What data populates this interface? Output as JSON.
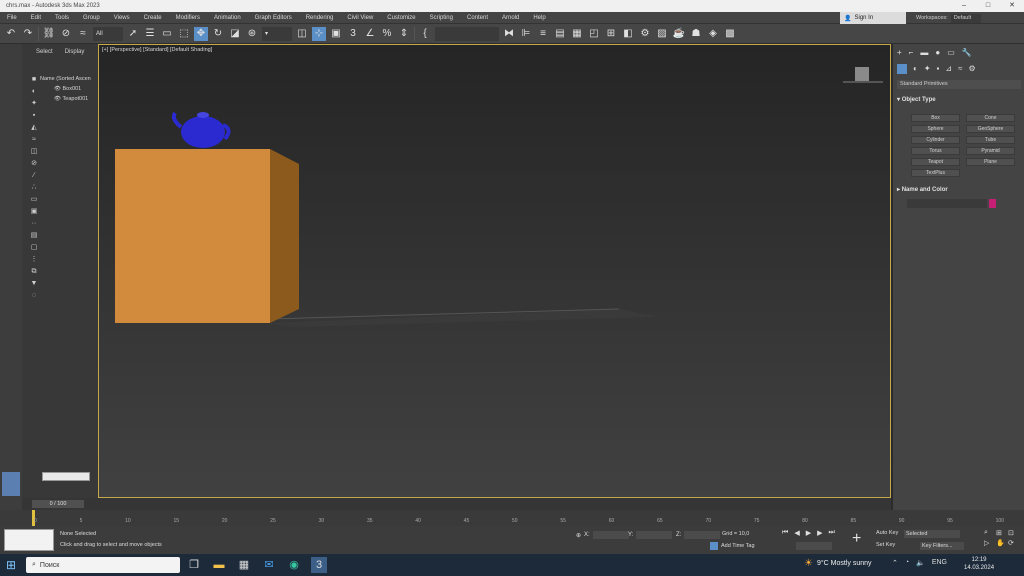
{
  "window": {
    "title": "chrs.max - Autodesk 3ds Max 2023",
    "controls": [
      "–",
      "□",
      "✕"
    ]
  },
  "menubar": {
    "items": [
      "File",
      "Edit",
      "Tools",
      "Group",
      "Views",
      "Create",
      "Modifiers",
      "Animation",
      "Graph Editors",
      "Rendering",
      "Civil View",
      "Customize",
      "Scripting",
      "Content",
      "Arnold",
      "Help"
    ],
    "sign_in": "Sign In",
    "workspaces_label": "Workspaces:",
    "workspace_value": "Default"
  },
  "toolbar": {
    "selection_filter": "All",
    "icons": [
      "undo-icon",
      "redo-icon",
      "link-icon",
      "unlink-icon",
      "bind-space-warp-icon",
      "select-icon",
      "select-by-name-icon",
      "rect-region-icon",
      "window-crossing-icon",
      "select-move-icon",
      "select-rotate-icon",
      "select-scale-icon",
      "placement-icon",
      "ref-coord-icon",
      "pivot-icon",
      "snap-icon",
      "angle-snap-icon",
      "percent-snap-icon",
      "spinner-snap-icon",
      "edit-named-sel-icon",
      "mirror-icon",
      "align-icon",
      "layer-icon",
      "toggle-ribbon-icon",
      "curve-editor-icon",
      "schematic-icon",
      "material-editor-icon",
      "render-setup-icon",
      "rendered-frame-icon",
      "render-icon"
    ],
    "accent": "#5b8fc7"
  },
  "scene_explorer": {
    "tabs": [
      "Select",
      "Display"
    ],
    "items": [
      {
        "label": "Name (Sorted Ascen"
      },
      {
        "label": "Box001"
      },
      {
        "label": "Teapot001"
      }
    ]
  },
  "viewport": {
    "label": "[+] [Perspective] [Standard] [Default Shading]",
    "border_color": "#c4a84a",
    "box_color": "#d28a3c",
    "teapot_color": "#2a2ad0"
  },
  "command_panel": {
    "dropdown": "Standard Primitives",
    "object_type_title": "Object Type",
    "object_types": [
      "Box",
      "Cone",
      "Sphere",
      "GeoSphere",
      "Cylinder",
      "Tube",
      "Torus",
      "Pyramid",
      "Teapot",
      "Plane",
      "TextPlus"
    ],
    "name_color_title": "Name and Color",
    "object_color": "#c41f74"
  },
  "timeline": {
    "frame_display": "0 / 100",
    "ticks": [
      "0",
      "5",
      "10",
      "15",
      "20",
      "25",
      "30",
      "35",
      "40",
      "45",
      "50",
      "55",
      "60",
      "65",
      "70",
      "75",
      "80",
      "85",
      "90",
      "95",
      "100"
    ]
  },
  "status": {
    "selection": "None Selected",
    "prompt": "Click and drag to select and move objects",
    "x_label": "X:",
    "y_label": "Y:",
    "z_label": "Z:",
    "grid": "Grid = 10,0",
    "add_time_tag": "Add Time Tag",
    "auto_key": "Auto Key",
    "set_key": "Set Key",
    "selected_dd": "Selected",
    "key_filters": "Key Filters..."
  },
  "taskbar": {
    "search_placeholder": "Поиск",
    "weather": "9°C  Mostly sunny",
    "lang": "ENG",
    "time": "12:19",
    "date": "14.03.2024"
  }
}
